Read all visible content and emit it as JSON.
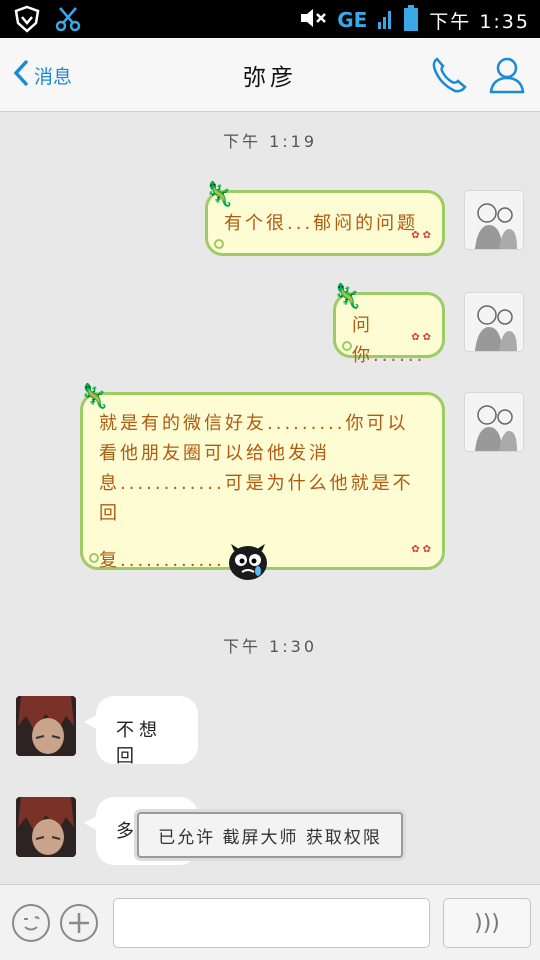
{
  "status_bar": {
    "network": "GE",
    "time": "下午 1:35",
    "icons": [
      "shield-icon",
      "scissors-icon",
      "mute-icon",
      "signal-icon",
      "battery-icon"
    ]
  },
  "header": {
    "back_label": "消息",
    "title": "弥彦",
    "icons": [
      "chevron-left-icon",
      "phone-icon",
      "person-icon"
    ]
  },
  "chat": {
    "time_labels": [
      "下午 1:19",
      "下午 1:30"
    ],
    "messages": [
      {
        "sender": "me",
        "text": "有个很...郁闷的问题"
      },
      {
        "sender": "me",
        "text": "问你......"
      },
      {
        "sender": "me",
        "lines": [
          "就是有的微信好友.........你可以",
          "看他朋友圈可以给他发消",
          "息............可是为什么他就是不回",
          "复............"
        ]
      },
      {
        "sender": "other",
        "text": "不想回"
      },
      {
        "sender": "other",
        "text": "多"
      }
    ]
  },
  "toast": {
    "text": "已允许 截屏大师 获取权限"
  },
  "input_bar": {
    "placeholder": "",
    "voice_label": ")))"
  },
  "colors": {
    "accent": "#1a8ad8",
    "bubble_me_bg": "#fdfcd2",
    "bubble_me_border": "#9ccc63",
    "bubble_me_text": "#b05a12"
  }
}
